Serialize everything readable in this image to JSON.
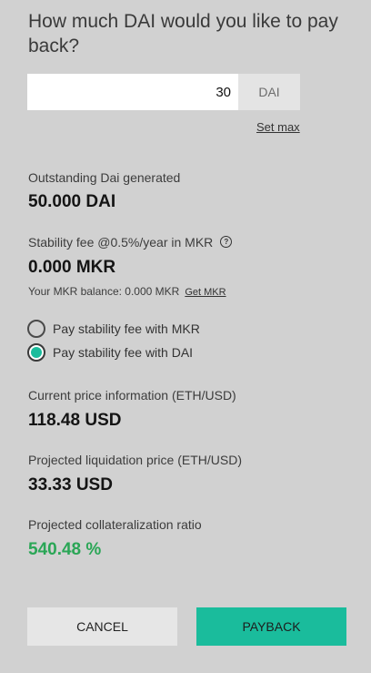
{
  "heading": "How much DAI would you like to pay back?",
  "amount": {
    "value": "30",
    "unit": "DAI",
    "set_max_label": "Set max"
  },
  "outstanding": {
    "label": "Outstanding Dai generated",
    "value": "50.000 DAI"
  },
  "stability_fee": {
    "label": "Stability fee @0.5%/year in MKR",
    "help_icon": "?",
    "value": "0.000 MKR",
    "balance_text": "Your MKR balance: 0.000 MKR",
    "get_mkr_label": "Get MKR"
  },
  "fee_options": [
    {
      "label": "Pay stability fee with MKR",
      "checked": false
    },
    {
      "label": "Pay stability fee with DAI",
      "checked": true
    }
  ],
  "current_price": {
    "label": "Current price information (ETH/USD)",
    "value": "118.48 USD"
  },
  "liquidation_price": {
    "label": "Projected liquidation price (ETH/USD)",
    "value": "33.33 USD"
  },
  "collateral_ratio": {
    "label": "Projected collateralization ratio",
    "value": "540.48 %"
  },
  "buttons": {
    "cancel": "CANCEL",
    "payback": "PAYBACK"
  },
  "colors": {
    "background": "#d1d1d1",
    "accent": "#1abc9c",
    "ratio_green": "#2aa656"
  }
}
